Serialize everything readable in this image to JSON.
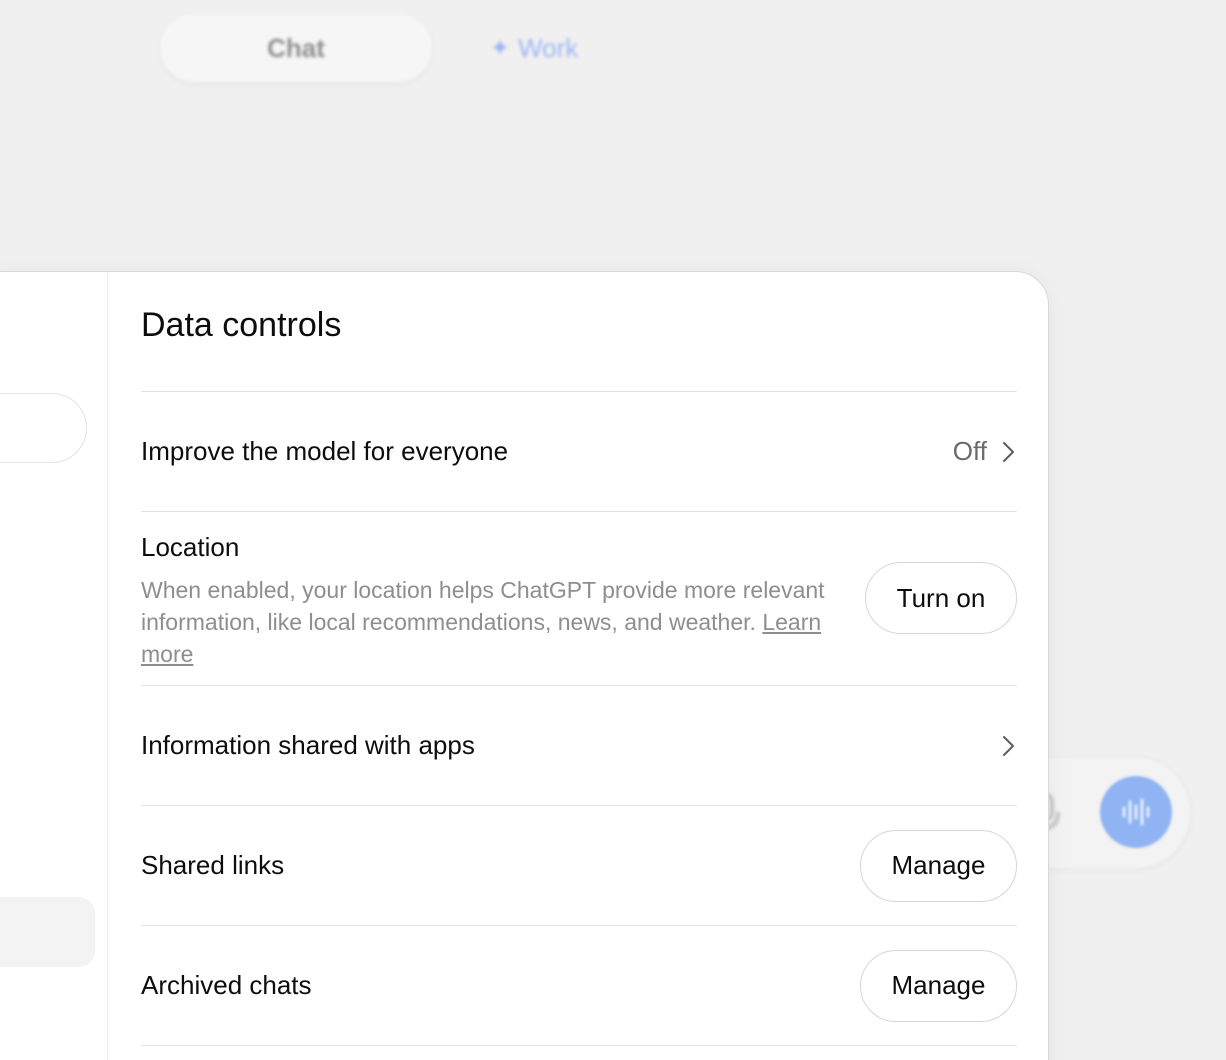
{
  "background": {
    "tabs": [
      {
        "label": "Chat"
      },
      {
        "label": "Work",
        "icon": "sparkle-icon"
      }
    ],
    "composer": {
      "mic_icon": "microphone-icon",
      "voice_icon": "voice-waveform-icon",
      "voice_color": "#8fb3f3"
    }
  },
  "dialog": {
    "title": "Data controls",
    "rows": {
      "improve": {
        "label": "Improve the model for everyone",
        "value": "Off"
      },
      "location": {
        "label": "Location",
        "description": "When enabled, your location helps ChatGPT provide more relevant information, like local recommendations, news, and weather.",
        "link": "Learn more",
        "button": "Turn on"
      },
      "apps": {
        "label": "Information shared with apps"
      },
      "shared_links": {
        "label": "Shared links",
        "button": "Manage"
      },
      "archived": {
        "label": "Archived chats",
        "button": "Manage"
      }
    }
  },
  "colors": {
    "background": "#f0f0f0",
    "dialog": "#ffffff",
    "text": "#0d0d0d",
    "muted": "#8e8e8e",
    "divider": "#e3e3e3",
    "accent_blue": "#9db6f2"
  }
}
